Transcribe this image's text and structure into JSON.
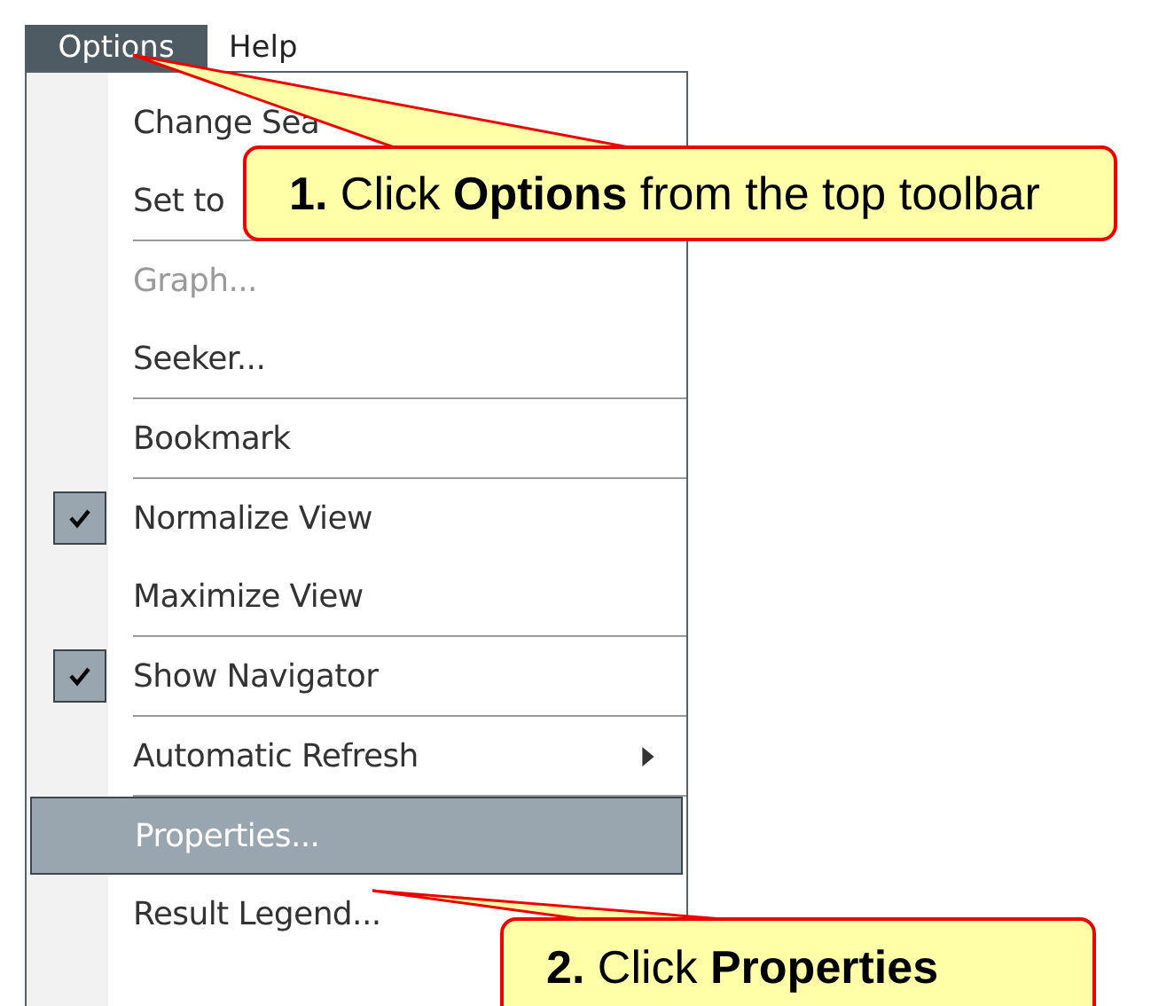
{
  "menu_bar": [
    {
      "label": "Options",
      "selected": true
    },
    {
      "label": "Help",
      "selected": false
    }
  ],
  "menu": {
    "items": [
      {
        "kind": "item",
        "label": "Change Sea",
        "checked": false,
        "disabled": false,
        "submenu": false,
        "selected": false
      },
      {
        "kind": "item",
        "label": "Set to",
        "checked": false,
        "disabled": false,
        "selected": false
      },
      {
        "kind": "separator"
      },
      {
        "kind": "item",
        "label": "Graph...",
        "checked": false,
        "disabled": true,
        "submenu": false,
        "selected": false
      },
      {
        "kind": "item",
        "label": "Seeker...",
        "checked": false,
        "disabled": false,
        "submenu": false,
        "selected": false
      },
      {
        "kind": "separator"
      },
      {
        "kind": "item",
        "label": "Bookmark",
        "checked": false,
        "disabled": false,
        "submenu": false,
        "selected": false
      },
      {
        "kind": "separator"
      },
      {
        "kind": "item",
        "label": "Normalize View",
        "checked": true,
        "disabled": false,
        "submenu": false,
        "selected": false
      },
      {
        "kind": "item",
        "label": "Maximize View",
        "checked": false,
        "disabled": false,
        "submenu": false,
        "selected": false
      },
      {
        "kind": "separator"
      },
      {
        "kind": "item",
        "label": "Show Navigator",
        "checked": true,
        "disabled": false,
        "submenu": false,
        "selected": false
      },
      {
        "kind": "separator"
      },
      {
        "kind": "item",
        "label": "Automatic Refresh",
        "checked": false,
        "disabled": false,
        "submenu": true,
        "selected": false
      },
      {
        "kind": "separator"
      },
      {
        "kind": "item",
        "label": "Properties...",
        "checked": false,
        "disabled": false,
        "submenu": false,
        "selected": true
      },
      {
        "kind": "item",
        "label": "Result Legend...",
        "checked": false,
        "disabled": false,
        "submenu": false,
        "selected": false
      }
    ]
  },
  "callouts": [
    {
      "text": "**1.** Click **Options** from the top toolbar"
    },
    {
      "text": "**2.** Click **Properties**"
    }
  ]
}
